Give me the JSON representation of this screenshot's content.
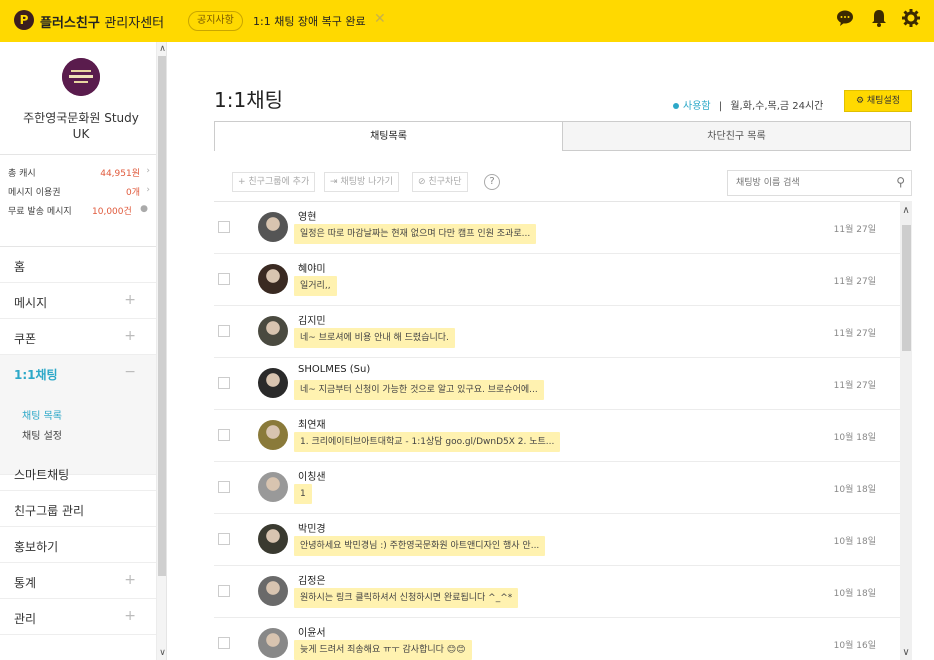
{
  "topbar": {
    "logo_glyph": "P",
    "brand_name": "플러스친구",
    "brand_sub": "관리자센터",
    "notice_badge": "공지사항",
    "notice_text": "1:1 채팅 장애 복구 완료",
    "icons": [
      "chat-icon",
      "bell-icon",
      "gear-icon"
    ]
  },
  "sidebar": {
    "profile_name": "주한영국문화원 Study UK",
    "stats": [
      {
        "label": "총 캐시",
        "value": "44,951원"
      },
      {
        "label": "메시지 이용권",
        "value": "0개"
      },
      {
        "label": "무료 발송 메시지",
        "value": "10,000건"
      }
    ],
    "menu": [
      {
        "label": "홈",
        "expandable": false
      },
      {
        "label": "메시지",
        "expandable": true
      },
      {
        "label": "쿠폰",
        "expandable": true
      },
      {
        "label": "1:1채팅",
        "expandable": true,
        "active": true
      },
      {
        "label": "스마트채팅",
        "expandable": false
      },
      {
        "label": "친구그룹 관리",
        "expandable": false
      },
      {
        "label": "홍보하기",
        "expandable": false
      },
      {
        "label": "통계",
        "expandable": true
      },
      {
        "label": "관리",
        "expandable": true
      }
    ],
    "submenu": [
      "채팅 목록",
      "채팅 설정"
    ]
  },
  "main": {
    "title": "1:1채팅",
    "status_on": "사용함",
    "separator": "|",
    "schedule": "월,화,수,목,금  24시간",
    "settings_button": "채팅설정",
    "tabs": [
      "채팅목록",
      "차단친구 목록"
    ],
    "toolbar": {
      "add_group": "+ 친구그룹에 추가",
      "leave_room": "채팅방 나가기",
      "block": "친구차단",
      "help": "?"
    },
    "search_placeholder": "채팅방 이름 검색",
    "rows": [
      {
        "name": "영현",
        "message": "일정은 따로 마감날짜는 현재 없으며 다만 캠프 인원 조과로...",
        "date": "11월 27일",
        "avatar_color": "#555"
      },
      {
        "name": "혜야미",
        "message": "일거리,,",
        "date": "11월 27일",
        "avatar_color": "#3a2a22"
      },
      {
        "name": "김지민",
        "message": "네~ 브로셔에 비용 안내 해 드렸습니다.",
        "date": "11월 27일",
        "avatar_color": "#4a4a40"
      },
      {
        "name": "SHOLMES (Su)",
        "message": "네~ 지금부터 신청이 가능한 것으로 알고 있구요. 브로슈어에...",
        "date": "11월 27일",
        "avatar_color": "#2a2a2a"
      },
      {
        "name": "최연재",
        "message": "1. 크리에이티브아트대학교 - 1:1상담 goo.gl/DwnD5X 2. 노트...",
        "date": "10월 18일",
        "avatar_color": "#8a7a3a"
      },
      {
        "name": "이칭샌",
        "message": "1",
        "date": "10월 18일",
        "avatar_color": "#999"
      },
      {
        "name": "박민경",
        "message": "안녕하세요 박민경님 :) 주한영국문화원 아트앤디자인 행사 안...",
        "date": "10월 18일",
        "avatar_color": "#3a3a30"
      },
      {
        "name": "김정은",
        "message": "원하시는 링크 클릭하셔서 신청하시면 완료됩니다 ^_^*",
        "date": "10월 18일",
        "avatar_color": "#6a6a6a"
      },
      {
        "name": "이윤서",
        "message": "늦게 드려서 죄송해요 ㅠㅜ 감사합니다 😊😊",
        "date": "10월 16일",
        "avatar_color": "#888"
      }
    ]
  },
  "colors": {
    "brand_yellow": "#ffd900",
    "accent": "#2da8c8",
    "bubble": "#fff2b0",
    "cash_red": "#e05a3c"
  }
}
